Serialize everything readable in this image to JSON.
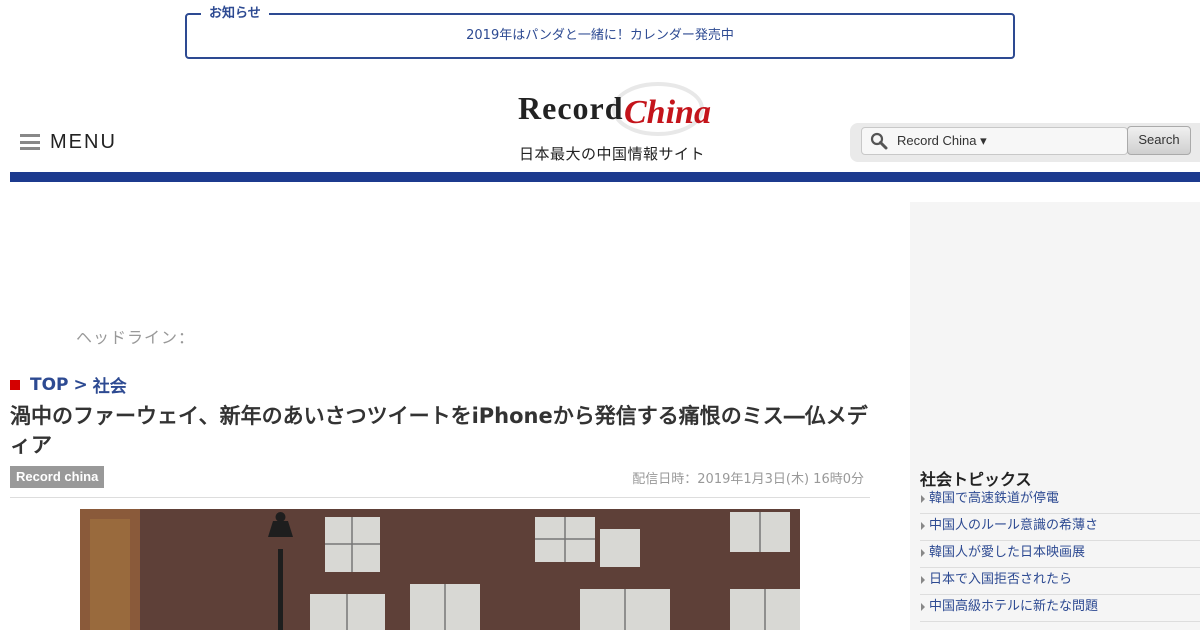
{
  "notice": {
    "title": "お知らせ",
    "text": "2019年はパンダと一緒に！カレンダー発売中"
  },
  "header": {
    "menu_label": "MENU",
    "logo_word": "Record",
    "logo_china": "China",
    "tagline": "日本最大の中国情報サイト",
    "search": {
      "scope": "Record China ▾",
      "button_label": "Search"
    }
  },
  "content": {
    "headline_label": "ヘッドライン：",
    "breadcrumb": {
      "top": "TOP",
      "separator": ">",
      "category": "社会"
    },
    "title": "渦中のファーウェイ、新年のあいさつツイートをiPhoneから発信する痛恨のミス―仏メディア",
    "source": "Record china",
    "date": "配信日時：2019年1月3日(木) 16時0分"
  },
  "sidebar": {
    "title": "社会トピックス",
    "topics": [
      "韓国で高速鉄道が停電",
      "中国人のルール意識の希薄さ",
      "韓国人が愛した日本映画展",
      "日本で入国拒否されたら",
      "中国高級ホテルに新たな問題"
    ]
  },
  "colors": {
    "brand_blue": "#1c3a8e",
    "link_blue": "#2d4a92",
    "logo_red": "#c4141b",
    "breadcrumb_marker": "#d40000"
  }
}
